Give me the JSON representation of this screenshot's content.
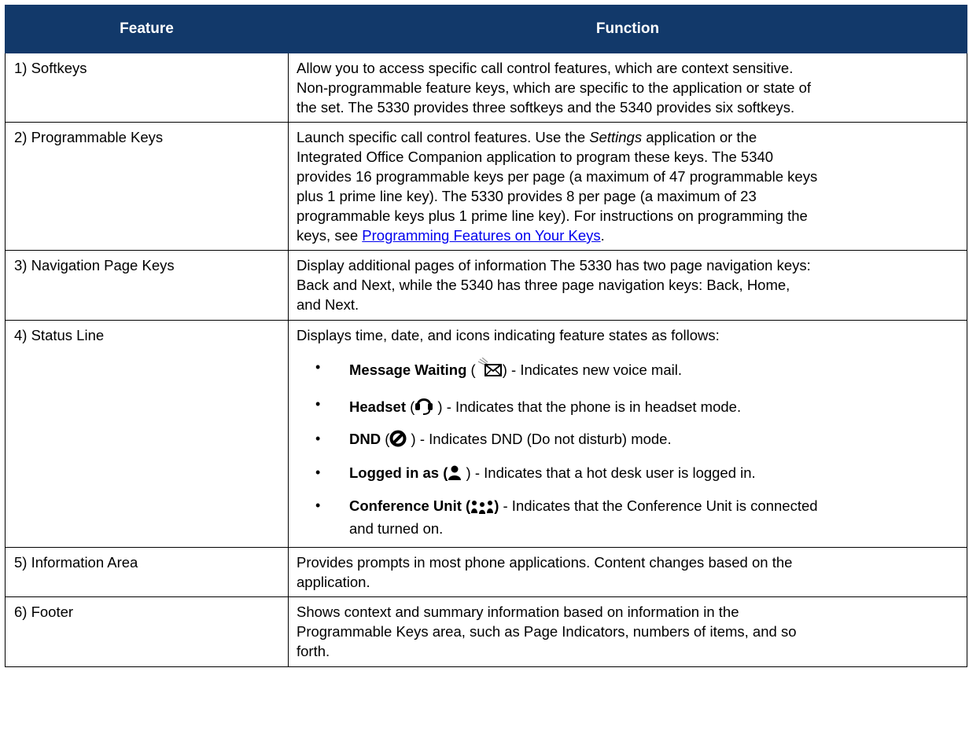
{
  "table": {
    "headers": {
      "feature": "Feature",
      "function": "Function"
    },
    "rows": [
      {
        "feature": "1) Softkeys",
        "lines": [
          "Allow you to access specific call control features, which are context sensitive.",
          "Non-programmable feature keys, which are specific to the application or state of",
          "the set. The 5330 provides three softkeys and the 5340 provides six softkeys."
        ]
      },
      {
        "feature": "2) Programmable Keys",
        "line1_a": "Launch specific call control features. Use the ",
        "line1_em": "Settings",
        "line1_b": " application or the",
        "lines": [
          "Integrated Office Companion application to program these keys. The 5340",
          "provides 16 programmable keys per page (a maximum of 47 programmable keys",
          "plus 1 prime line key). The 5330 provides 8 per page (a maximum of 23",
          "programmable keys plus 1 prime line key). For instructions on programming the"
        ],
        "last_prefix": "keys, see ",
        "link": "Programming Features on Your Keys",
        "last_suffix": "."
      },
      {
        "feature": "3) Navigation Page Keys",
        "lines": [
          "Display additional pages of information The 5330 has two page navigation keys:",
          "Back and Next, while the 5340 has three page navigation keys: Back, Home,",
          "and Next."
        ]
      },
      {
        "feature": "4) Status Line",
        "intro": "Displays time, date, and icons indicating feature states as follows:",
        "states": [
          {
            "label": "Message Waiting",
            "open": " (",
            "icon": "message-waiting-icon",
            "close": ")",
            "desc": " - Indicates new voice mail."
          },
          {
            "label": "Headset",
            "open": " (",
            "icon": "headset-icon",
            "close": " )",
            "desc": " - Indicates that the phone is in headset mode."
          },
          {
            "label": "DND",
            "open": " (",
            "icon": "dnd-icon",
            "close": " )",
            "desc": " - Indicates DND (Do not disturb) mode."
          },
          {
            "label": "Logged in as (",
            "open": "",
            "icon": "user-icon",
            "close": " )",
            "desc": " - Indicates that a hot desk user is logged in."
          },
          {
            "label": "Conference Unit (",
            "open": "",
            "icon": "conference-unit-icon",
            "close": ")",
            "desc": " - Indicates that the Conference Unit is connected",
            "desc2": "and turned on."
          }
        ]
      },
      {
        "feature": "5) Information Area",
        "lines": [
          "Provides prompts in most phone applications. Content changes based on the",
          "application."
        ]
      },
      {
        "feature": "6) Footer",
        "lines": [
          "Shows context and summary information based on information in the",
          "Programmable Keys area, such as Page Indicators, numbers of items, and so",
          "forth."
        ]
      }
    ]
  },
  "colors": {
    "header_bg": "#12396a",
    "header_text": "#ffffff",
    "link": "#0000ee"
  }
}
